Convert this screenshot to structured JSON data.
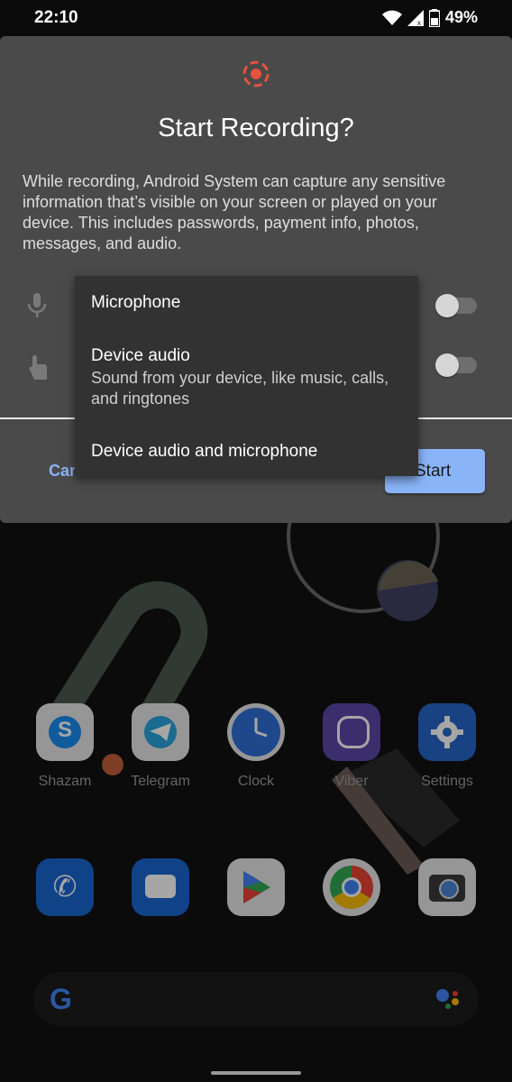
{
  "status_bar": {
    "time": "22:10",
    "battery": "49%"
  },
  "dialog": {
    "title": "Start Recording?",
    "body": "While recording, Android System can capture any sensitive information that’s visible on your screen or played on your device. This includes passwords, payment info, photos, messages, and audio.",
    "cancel_label": "Can",
    "start_label": "Start",
    "accent_color": "#8ab4f8",
    "record_icon_color": "#e5533d",
    "options": [
      {
        "icon": "microphone-icon",
        "enabled": false
      },
      {
        "icon": "touch-icon",
        "enabled": false
      }
    ]
  },
  "dropdown": {
    "items": [
      {
        "label": "Microphone",
        "sub": ""
      },
      {
        "label": "Device audio",
        "sub": "Sound from your device, like music, calls, and ringtones"
      },
      {
        "label": "Device audio and microphone",
        "sub": ""
      }
    ]
  },
  "home": {
    "apps_row1": [
      {
        "label": "Shazam",
        "icon": "shazam-icon"
      },
      {
        "label": "Telegram",
        "icon": "telegram-icon"
      },
      {
        "label": "Clock",
        "icon": "clock-icon"
      },
      {
        "label": "Viber",
        "icon": "viber-icon"
      },
      {
        "label": "Settings",
        "icon": "settings-icon"
      }
    ],
    "dock": [
      {
        "icon": "phone-icon"
      },
      {
        "icon": "messages-icon"
      },
      {
        "icon": "play-store-icon"
      },
      {
        "icon": "chrome-icon"
      },
      {
        "icon": "camera-icon"
      }
    ]
  }
}
